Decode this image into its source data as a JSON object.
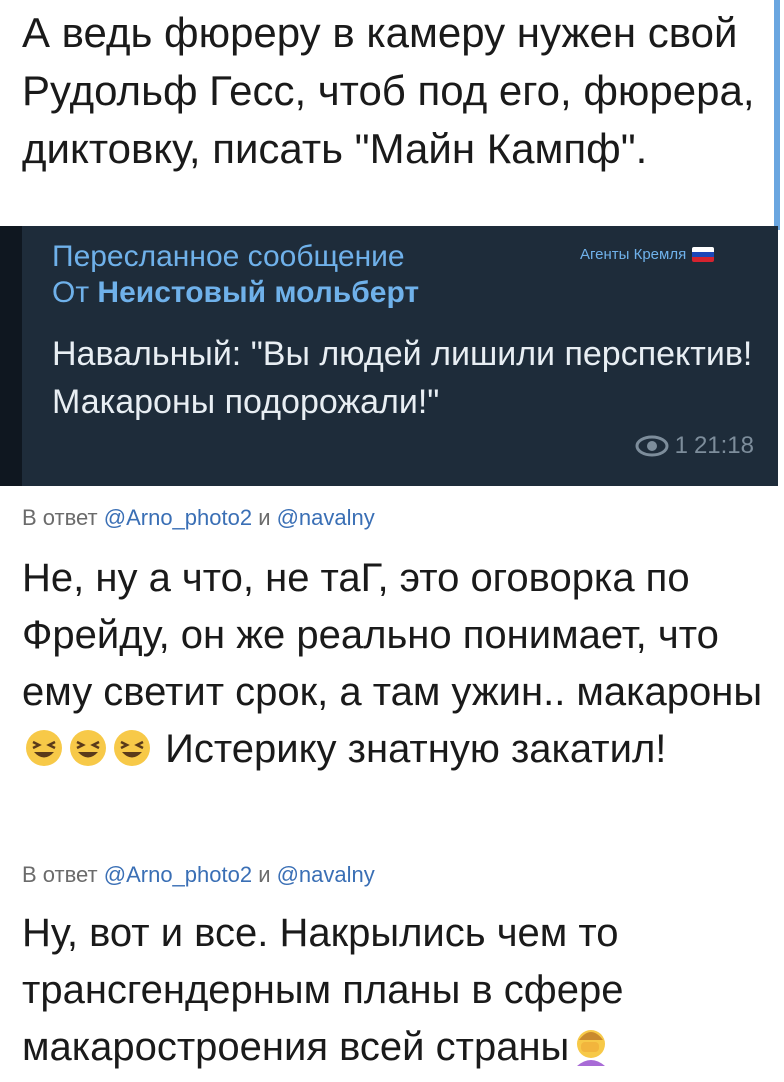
{
  "post": {
    "text": "А ведь фюреру в камеру нужен свой Рудольф Гесс, чтоб под его, фюрера, диктовку, писать \"Майн Кампф\"."
  },
  "forward": {
    "header": "Пересланное сообщение",
    "from_prefix": "От ",
    "from_name": "Неистовый мольберт",
    "channel": "Агенты Кремля",
    "body": "Навальный: \"Вы людей лишили перспектив! Макароны подорожали!\"",
    "views": "1",
    "time": "21:18"
  },
  "replies": [
    {
      "prefix": "В ответ ",
      "handle1": "@Arno_photo2",
      "and": " и ",
      "handle2": "@navalny",
      "text_before": "Не, ну а что, не таГ, это оговорка по Фрейду, он же реально понимает, что ему светит срок, а там ужин.. макароны",
      "text_after": " Истерику знатную закатил!"
    },
    {
      "prefix": "В ответ ",
      "handle1": "@Arno_photo2",
      "and": " и ",
      "handle2": "@navalny",
      "text_before": "Ну, вот и все. Накрылись чем то трансгендерным планы в сфере макаростроения всей страны"
    }
  ],
  "colors": {
    "forward_bg": "#1e2c3a",
    "accent": "#6fb1ea",
    "link": "#3a6fb5"
  }
}
